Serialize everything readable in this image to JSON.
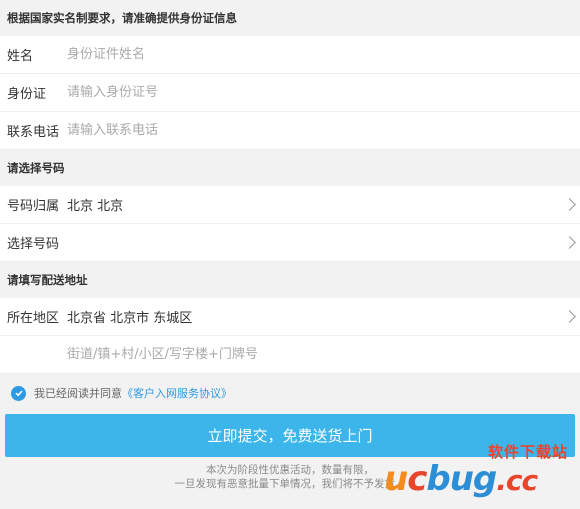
{
  "id_section": {
    "header": "根据国家实名制要求，请准确提供身份证信息",
    "name_label": "姓名",
    "name_placeholder": "身份证件姓名",
    "idcard_label": "身份证",
    "idcard_placeholder": "请输入身份证号",
    "phone_label": "联系电话",
    "phone_placeholder": "请输入联系电话"
  },
  "number_section": {
    "header": "请选择号码",
    "region_label": "号码归属",
    "region_value": "北京 北京",
    "choose_label": "选择号码"
  },
  "address_section": {
    "header": "请填写配送地址",
    "area_label": "所在地区",
    "area_value": "北京省 北京市 东城区",
    "street_placeholder": "街道/镇+村/小区/写字楼+门牌号"
  },
  "agreement": {
    "text": "我已经阅读并同意",
    "link": "《客户入网服务协议》",
    "checked": true
  },
  "submit_label": "立即提交，免费送货上门",
  "notice": {
    "line1": "本次为阶段性优惠活动，数量有限，",
    "line2": "一旦发现有恶意批量下单情况，我们将不予发货。"
  },
  "watermark": {
    "top": "软件下载站",
    "u": "u",
    "c": "c",
    "bug": "bug",
    "g": "",
    "dotcc": ".cc"
  },
  "colors": {
    "accent": "#3bb5ea",
    "link": "#2d9be3"
  }
}
